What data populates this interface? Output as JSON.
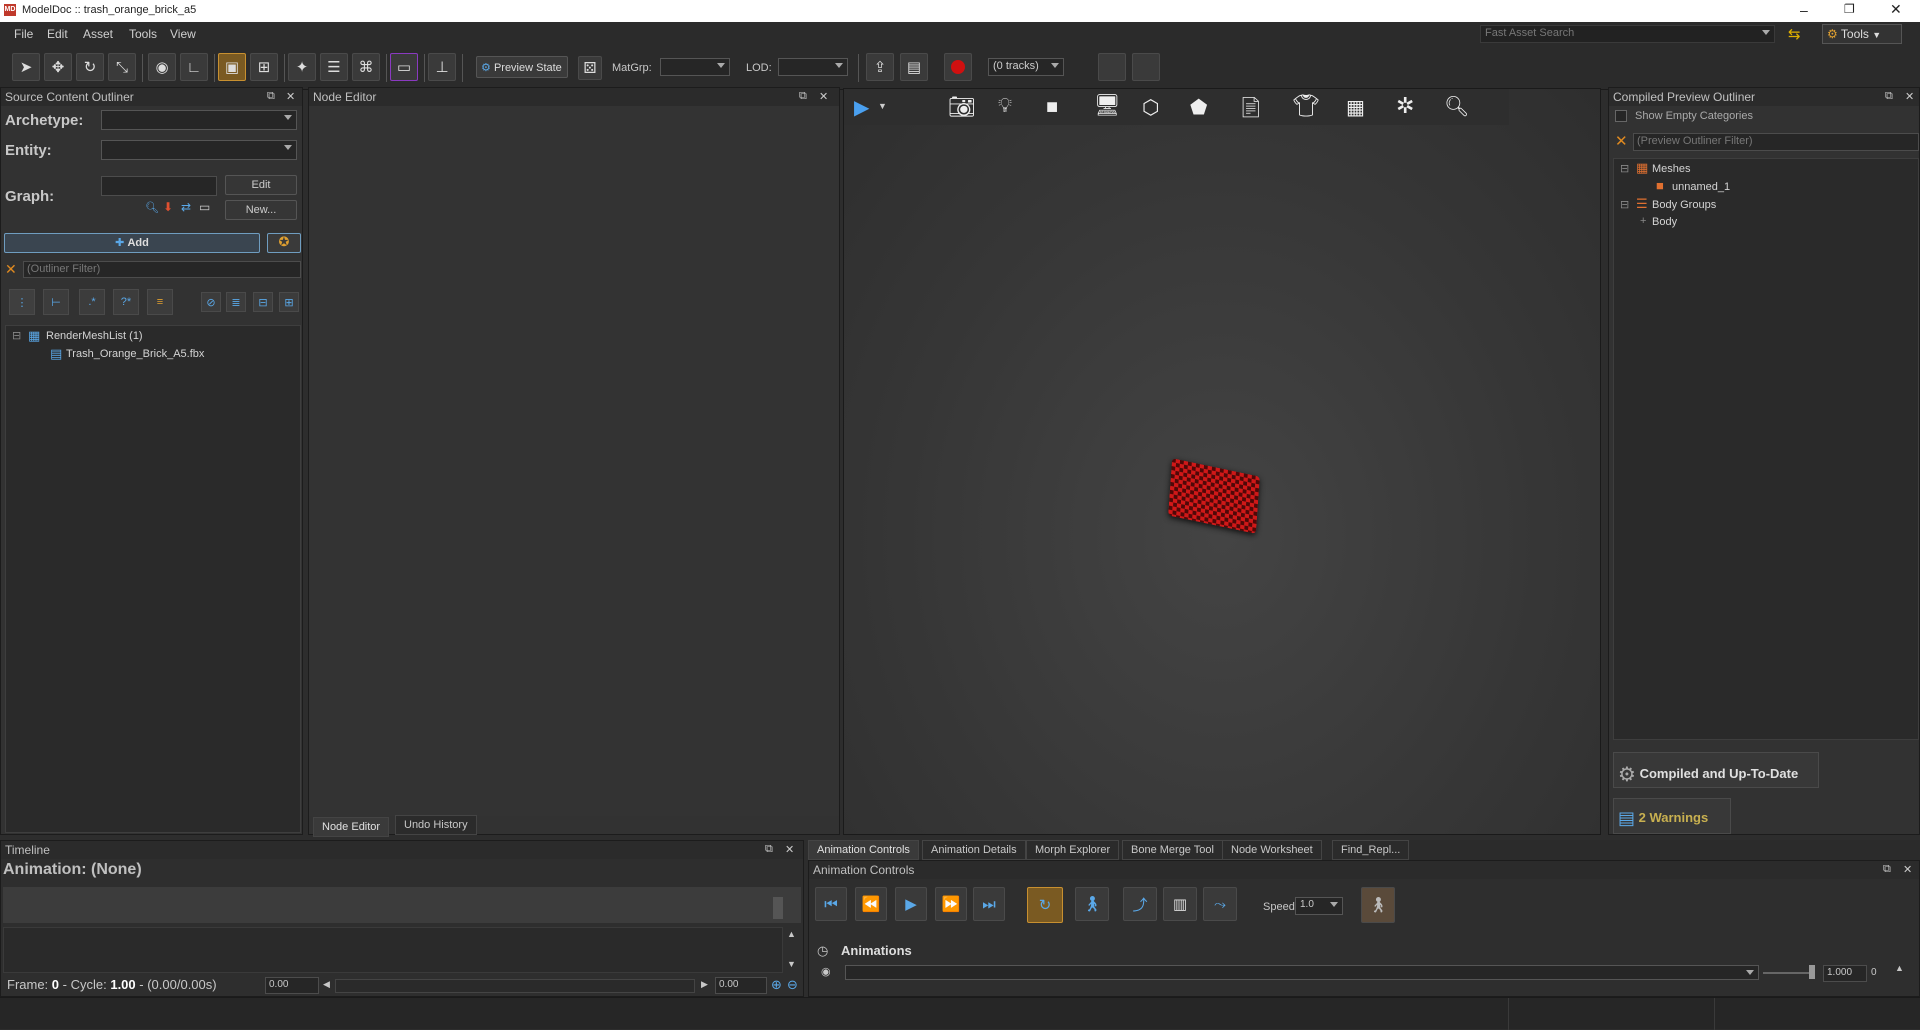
{
  "window": {
    "title": "ModelDoc :: trash_orange_brick_a5"
  },
  "menu": [
    "File",
    "Edit",
    "Asset",
    "Tools",
    "View"
  ],
  "top_right": {
    "search_placeholder": "Fast Asset Search",
    "tools_label": "Tools"
  },
  "toolbar": {
    "preview_state_label": "Preview State",
    "matgrp_label": "MatGrp:",
    "lod_label": "LOD:",
    "tracks_value": "(0 tracks)"
  },
  "source_outliner": {
    "title": "Source Content Outliner",
    "archetype_label": "Archetype:",
    "entity_label": "Entity:",
    "graph_label": "Graph:",
    "edit_label": "Edit",
    "new_label": "New...",
    "add_label": "Add",
    "filter_placeholder": "(Outliner Filter)",
    "tree": [
      {
        "label": "RenderMeshList (1)"
      },
      {
        "label": "Trash_Orange_Brick_A5.fbx"
      }
    ]
  },
  "node_editor": {
    "title": "Node Editor",
    "tabs": [
      "Node Editor",
      "Undo History"
    ]
  },
  "compiled_outliner": {
    "title": "Compiled Preview Outliner",
    "show_empty": "Show Empty Categories",
    "filter_placeholder": "(Preview Outliner Filter)",
    "tree": [
      "Meshes",
      "unnamed_1",
      "Body Groups",
      "Body"
    ],
    "status": "Compiled and Up-To-Date",
    "warnings": "2 Warnings"
  },
  "timeline": {
    "title": "Timeline",
    "animation": "Animation: (None)",
    "frame_prefix": "Frame:",
    "frame_value": "0",
    "cycle_prefix": "- Cycle:",
    "cycle_value": "1.00",
    "time_range": "- (0.00/0.00s)",
    "start": "0.00",
    "end": "0.00"
  },
  "bottom_tabs": [
    "Animation Controls",
    "Animation Details",
    "Morph Explorer",
    "Bone Merge Tool",
    "Node Worksheet",
    "Find_Repl..."
  ],
  "anim_controls": {
    "title": "Animation Controls",
    "speed_label": "Speed",
    "speed_value": "1.0",
    "animations_label": "Animations",
    "weight_value": "1.000",
    "index_value": "0"
  },
  "colors": {
    "accent": "#c89030",
    "blue": "#5aa8e8",
    "mesh": "#c81010"
  }
}
